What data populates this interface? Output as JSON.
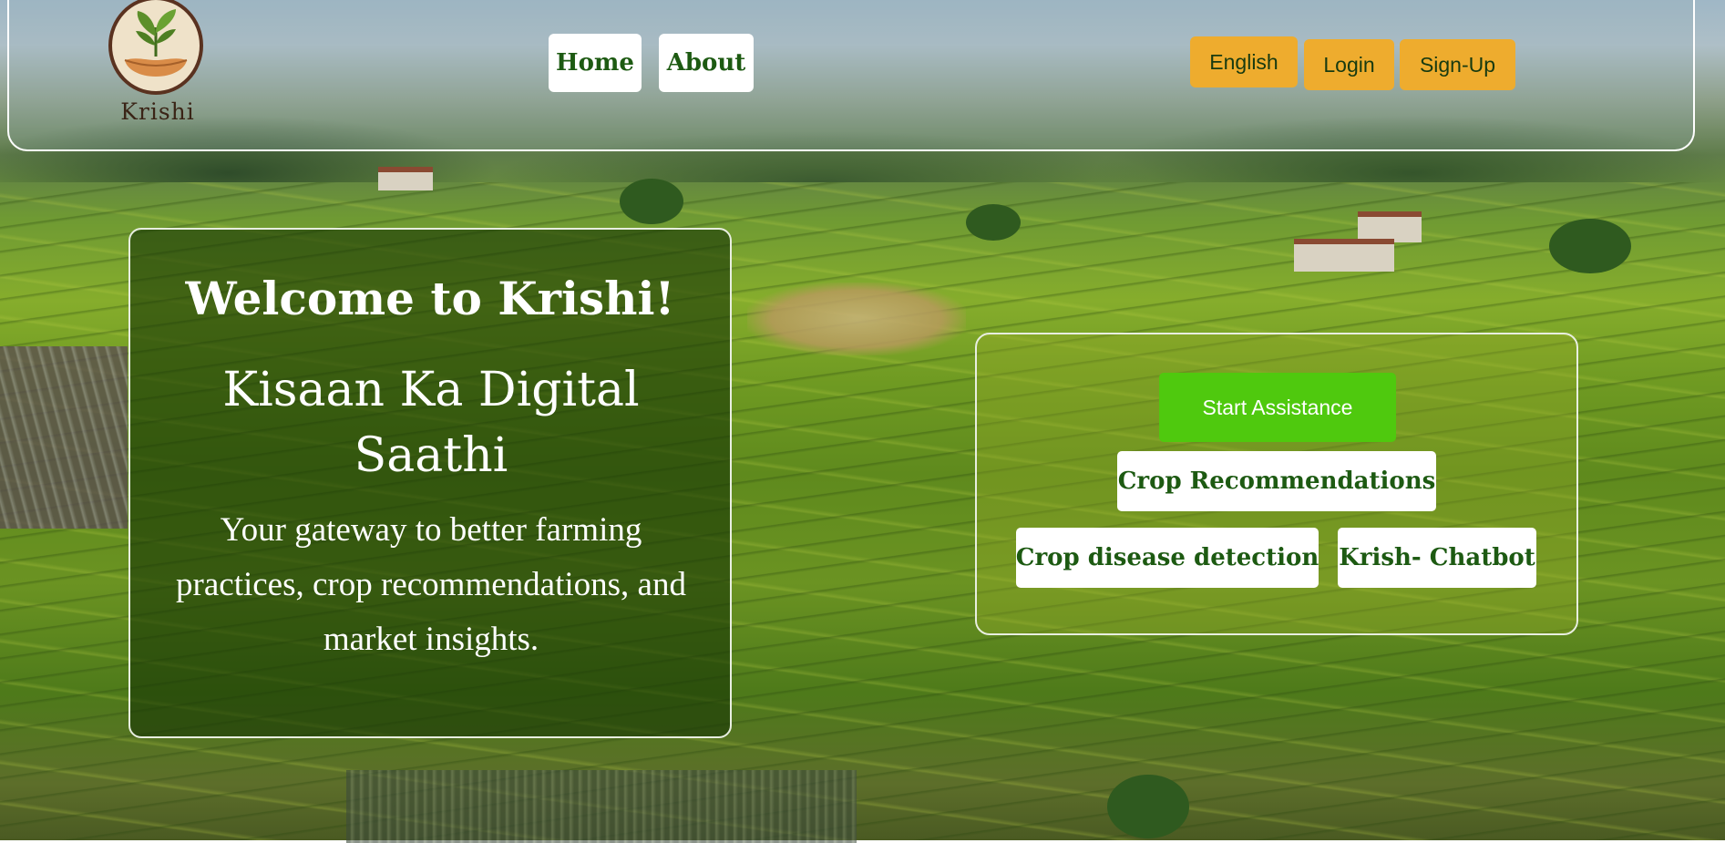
{
  "header": {
    "logo_text": "Krishi",
    "nav": {
      "home": "Home",
      "about": "About"
    },
    "language_label": "English",
    "login_label": "Login",
    "signup_label": "Sign-Up"
  },
  "hero": {
    "title": "Welcome to Krishi!",
    "subtitle": "Kisaan Ka Digital Saathi",
    "description": "Your gateway to better farming practices, crop recommendations, and market insights."
  },
  "actions": {
    "start_label": "Start Assistance",
    "crop_recommendations_label": "Crop Recommendations",
    "disease_detection_label": "Crop disease detection",
    "chatbot_label": "Krish- Chatbot"
  },
  "colors": {
    "accent_yellow": "#eeac2e",
    "start_green": "#4fc90e",
    "text_green": "#1d5a12"
  },
  "icons": {
    "logo": "plant-in-hands-logo"
  }
}
